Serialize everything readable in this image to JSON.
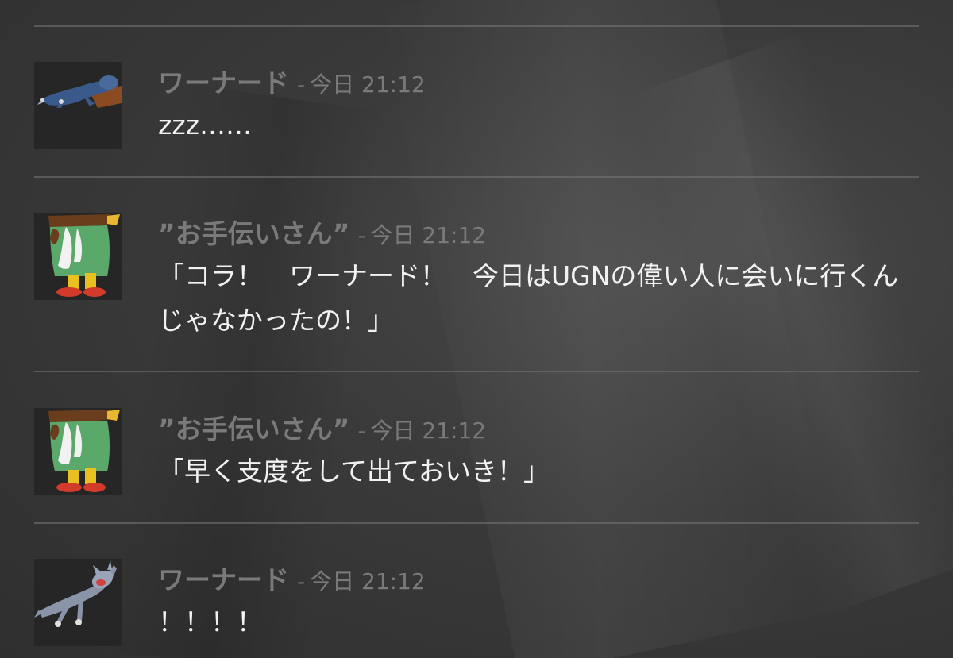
{
  "messages": [
    {
      "author": "ワーナード",
      "separator": "-",
      "time": "今日 21:12",
      "text": "zzz……",
      "avatar_icon": "sleeping-cat-icon"
    },
    {
      "author": "”お手伝いさん”",
      "separator": "-",
      "time": "今日 21:12",
      "text": "「コラ！　ワーナード！　今日はUGNの偉い人に会いに行くんじゃなかったの！」",
      "avatar_icon": "housekeeper-icon"
    },
    {
      "author": "”お手伝いさん”",
      "separator": "-",
      "time": "今日 21:12",
      "text": "「早く支度をして出ておいき！」",
      "avatar_icon": "housekeeper-icon"
    },
    {
      "author": "ワーナード",
      "separator": "-",
      "time": "今日 21:12",
      "text": "！！！！",
      "avatar_icon": "startled-cat-icon"
    }
  ],
  "colors": {
    "author": "#7a7a7a",
    "message_text": "#f2f2f2",
    "divider": "#787878"
  }
}
